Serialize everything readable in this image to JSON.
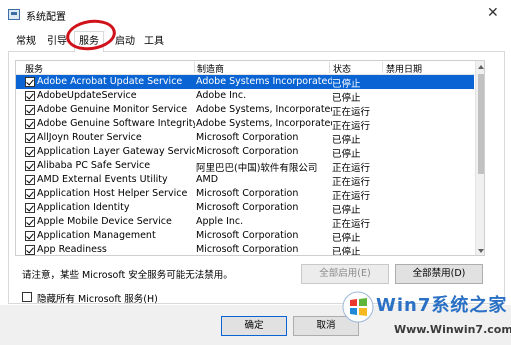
{
  "window": {
    "title": "系统配置",
    "close_glyph": "✕"
  },
  "tabs": [
    {
      "label": "常规"
    },
    {
      "label": "引导"
    },
    {
      "label": "服务"
    },
    {
      "label": "启动"
    },
    {
      "label": "工具"
    }
  ],
  "table": {
    "columns": [
      "服务",
      "制造商",
      "状态",
      "禁用日期"
    ],
    "rows": [
      {
        "name": "Adobe Acrobat Update Service",
        "maker": "Adobe Systems Incorporated",
        "state": "已停止"
      },
      {
        "name": "AdobeUpdateService",
        "maker": "Adobe Inc.",
        "state": "已停止"
      },
      {
        "name": "Adobe Genuine Monitor Service",
        "maker": "Adobe Systems, Incorporated",
        "state": "正在运行"
      },
      {
        "name": "Adobe Genuine Software Integrity...",
        "maker": "Adobe Systems, Incorporated",
        "state": "正在运行"
      },
      {
        "name": "AllJoyn Router Service",
        "maker": "Microsoft Corporation",
        "state": "已停止"
      },
      {
        "name": "Application Layer Gateway Service",
        "maker": "Microsoft Corporation",
        "state": "已停止"
      },
      {
        "name": "Alibaba PC Safe Service",
        "maker": "阿里巴巴(中国)软件有限公司",
        "state": "正在运行"
      },
      {
        "name": "AMD External Events Utility",
        "maker": "AMD",
        "state": "正在运行"
      },
      {
        "name": "Application Host Helper Service",
        "maker": "Microsoft Corporation",
        "state": "正在运行"
      },
      {
        "name": "Application Identity",
        "maker": "Microsoft Corporation",
        "state": "已停止"
      },
      {
        "name": "Apple Mobile Device Service",
        "maker": "Apple Inc.",
        "state": "正在运行"
      },
      {
        "name": "Application Management",
        "maker": "Microsoft Corporation",
        "state": "已停止"
      },
      {
        "name": "App Readiness",
        "maker": "Microsoft Corporation",
        "state": "已停止"
      }
    ]
  },
  "note": "请注意，某些 Microsoft 安全服务可能无法禁用。",
  "buttons": {
    "enable_all": "全部启用(E)",
    "disable_all": "全部禁用(D)",
    "ok": "确定",
    "cancel": "取消"
  },
  "hide_ms_label": "隐藏所有 Microsoft 服务(H)",
  "watermark": {
    "brand": "Win7系统之家",
    "url": "Www.Winwin7.com"
  },
  "colors": {
    "selection": "#0a64d4",
    "annotation_circle": "#d0121b",
    "watermark_blue": "#2a70c4"
  }
}
